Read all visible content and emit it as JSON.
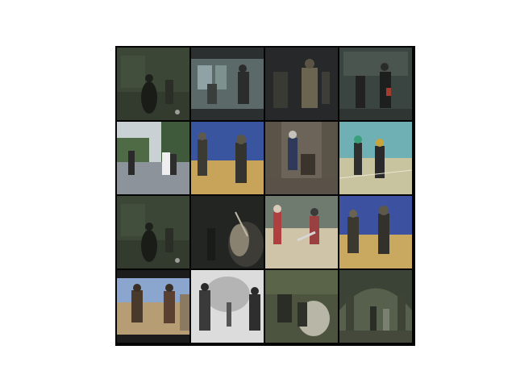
{
  "grid": {
    "rows": 4,
    "cols": 4,
    "tiles": [
      {
        "scene": "dark-indoor-group",
        "bg": "#3b4636",
        "ground": "#323b2e"
      },
      {
        "scene": "window-room",
        "bg": "#5b6a68",
        "ground": "#3a4140"
      },
      {
        "scene": "dark-indoor-fighters",
        "bg": "#26282a",
        "ground": "#1f2021"
      },
      {
        "scene": "dark-hall",
        "bg": "#3a4440",
        "ground": "#2e3532"
      },
      {
        "scene": "outdoor-road-trees",
        "bg": "#c9d1d4",
        "ground": "#8d939a"
      },
      {
        "scene": "gym-blue-wall",
        "bg": "#3a55a0",
        "ground": "#c7a45a"
      },
      {
        "scene": "stone-wall-fight",
        "bg": "#6c6458",
        "ground": "#5a5148"
      },
      {
        "scene": "gym-teal-court",
        "bg": "#6fb0b4",
        "ground": "#c9c4a0"
      },
      {
        "scene": "dark-indoor-group",
        "bg": "#3b4636",
        "ground": "#323b2e"
      },
      {
        "scene": "dark-cave-fighter",
        "bg": "#232523",
        "ground": "#2e2f2c"
      },
      {
        "scene": "sandy-yard",
        "bg": "#6f7b6e",
        "ground": "#cfc3a8"
      },
      {
        "scene": "gym-blue-wall-2",
        "bg": "#3c52a0",
        "ground": "#c9a860"
      },
      {
        "scene": "outdoor-field-sky",
        "bg": "#8aa6cf",
        "ground": "#b79d74"
      },
      {
        "scene": "white-studio",
        "bg": "#dcdcdc",
        "ground": "#c8c8c8"
      },
      {
        "scene": "greenish-fight",
        "bg": "#4c5440",
        "ground": "#5b5e4c"
      },
      {
        "scene": "arch-hall",
        "bg": "#56604c",
        "ground": "#44493c"
      }
    ]
  }
}
